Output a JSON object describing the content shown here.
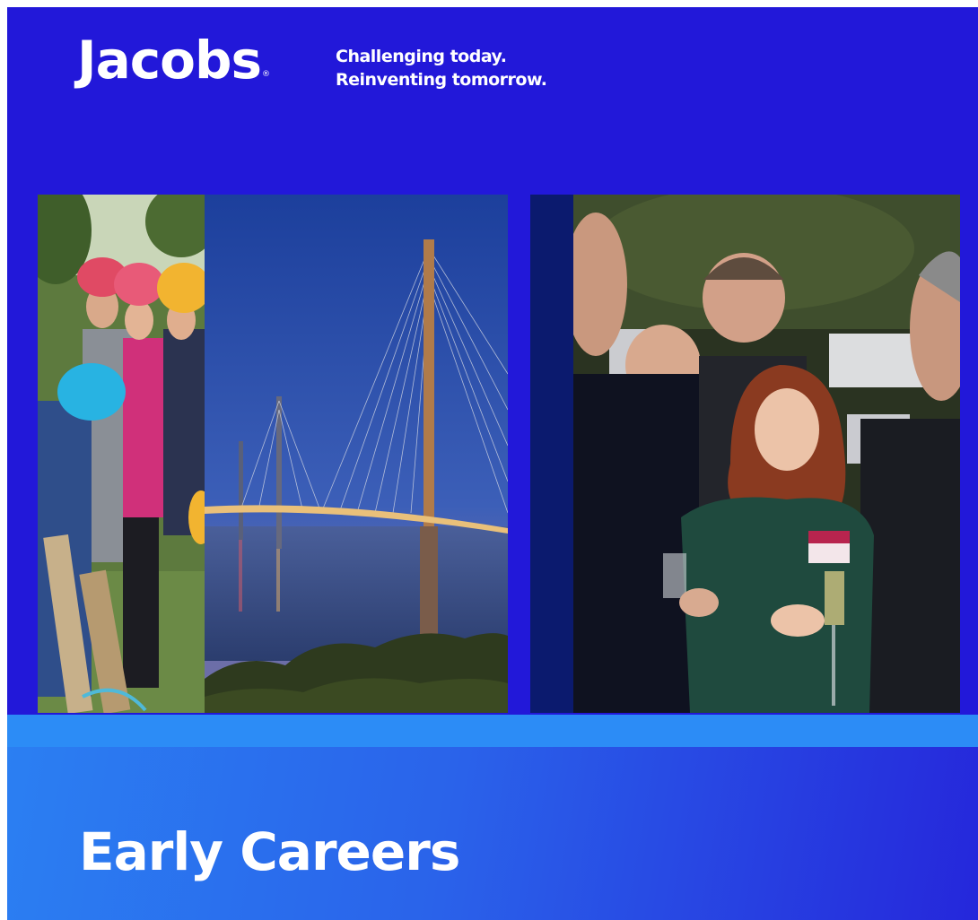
{
  "brand": {
    "logo_text": "Jacobs",
    "tagline_line1": "Challenging today.",
    "tagline_line2": "Reinventing tomorrow."
  },
  "photos": {
    "outdoor": "climbing-helmets-team-photo",
    "bridge": "cable-stayed-bridge-dusk-photo",
    "event": "networking-event-photo"
  },
  "banner": {
    "title": "Early Careers"
  },
  "colors": {
    "brand_blue": "#2218d9",
    "banner_light": "#2c8cf6",
    "text": "#ffffff"
  }
}
